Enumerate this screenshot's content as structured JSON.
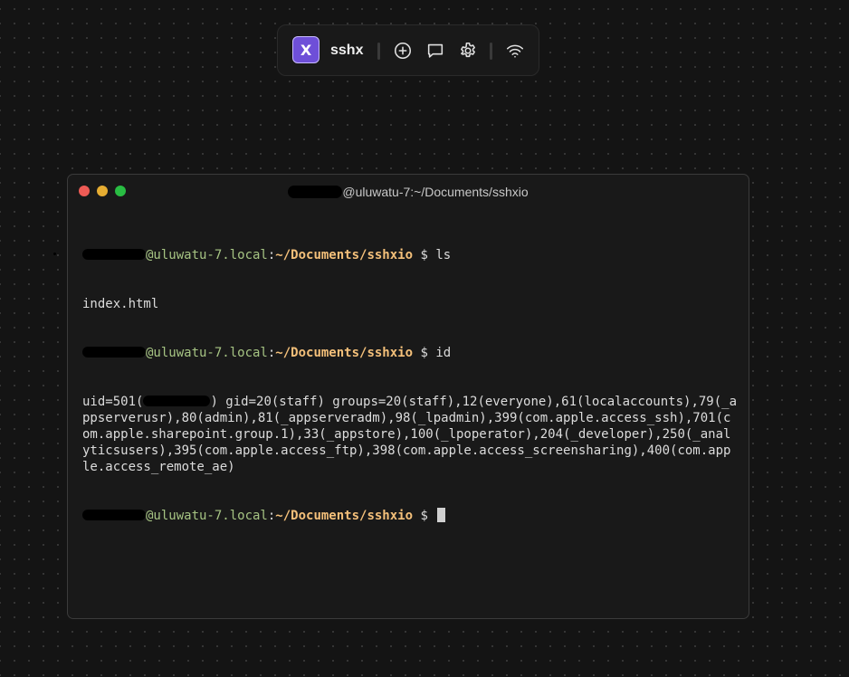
{
  "toolbar": {
    "logo_letter": "X",
    "app_name": "sshx",
    "icons": [
      "add-circle-icon",
      "chat-icon",
      "gear-icon",
      "wifi-icon"
    ]
  },
  "window": {
    "title_suffix": "@uluwatu-7:~/Documents/sshxio"
  },
  "terminal": {
    "host": "@uluwatu-7.local",
    "sep": ":",
    "path": "~/Documents/sshxio",
    "prompt_char": " $ ",
    "cmd1": "ls",
    "out1": "index.html",
    "cmd2": "id",
    "uid_prefix": "uid=501(",
    "uid_rest": ") gid=20(staff) groups=20(staff),12(everyone),61(localaccounts),79(_appserverusr),80(admin),81(_appserveradm),98(_lpadmin),399(com.apple.access_ssh),701(com.apple.sharepoint.group.1),33(_appstore),100(_lpoperator),204(_developer),250(_analyticsusers),395(com.apple.access_ftp),398(com.apple.access_screensharing),400(com.apple.access_remote_ae)"
  },
  "colors": {
    "host": "#a6c483",
    "path": "#f4c07a",
    "accent": "#6e4fd8"
  }
}
